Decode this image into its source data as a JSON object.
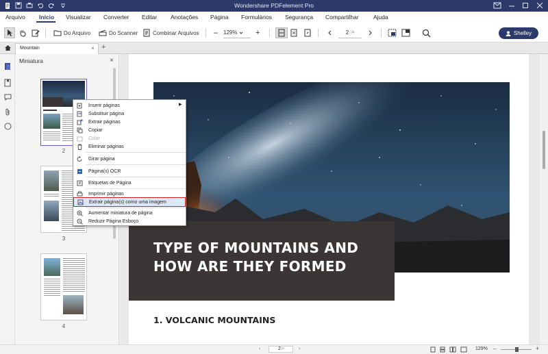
{
  "app": {
    "title": "Wondershare PDFelement Pro"
  },
  "menu": [
    "Arquivo",
    "Início",
    "Visualizar",
    "Converter",
    "Editar",
    "Anotações",
    "Página",
    "Formulários",
    "Segurança",
    "Compartilhar",
    "Ajuda"
  ],
  "toolbar": {
    "from_file": "Do Arquivo",
    "from_scanner": "Do Scanner",
    "combine": "Combinar Arquivos",
    "zoom": "129%",
    "page_current": "2",
    "page_total": "/4",
    "user": "Shelley"
  },
  "tab": {
    "name": "Mountain",
    "add": "+"
  },
  "panel": {
    "title": "Miniatura",
    "close": "×"
  },
  "thumbnails": [
    {
      "num": "2"
    },
    {
      "num": "3"
    },
    {
      "num": "4"
    }
  ],
  "context_menu": [
    "Inserir páginas",
    "Substituir página",
    "Extrair páginas",
    "Copiar",
    "Colar",
    "Eliminar páginas",
    "Girar página",
    "Página(s) OCR",
    "Etiquetas de Página",
    "Imprimir páginas",
    "Extrair página(s) como uma imagem",
    "Aumentar miniatura de página",
    "Reduzir Página Esboço"
  ],
  "document": {
    "title": "TYPE OF MOUNTAINS AND HOW ARE THEY FORMED",
    "heading": "1. VOLCANIC MOUNTAINS"
  },
  "status": {
    "page_current": "2",
    "page_total": "/4",
    "zoom": "129%"
  },
  "colors": {
    "titlebar": "#2c3a6b",
    "accent": "#2c3a6b",
    "highlight_border": "#d02020"
  }
}
